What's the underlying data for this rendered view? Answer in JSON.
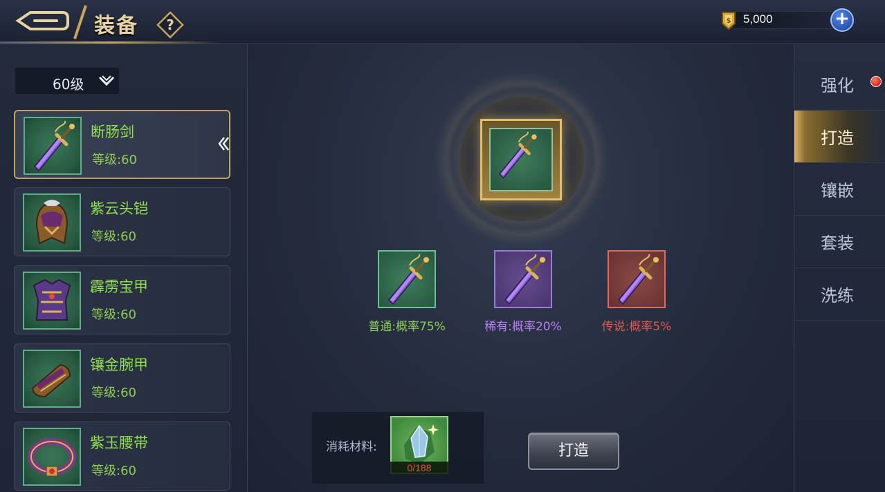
{
  "header": {
    "title": "装备",
    "help_symbol": "?",
    "currency": {
      "amount": "5,000",
      "plus": "+"
    }
  },
  "left": {
    "level_filter": "60级",
    "items": [
      {
        "name": "断肠剑",
        "level": "等级:60",
        "icon": "purple-sword-icon"
      },
      {
        "name": "紫云头铠",
        "level": "等级:60",
        "icon": "helmet-icon"
      },
      {
        "name": "霹雳宝甲",
        "level": "等级:60",
        "icon": "armor-icon"
      },
      {
        "name": "镶金腕甲",
        "level": "等级:60",
        "icon": "bracer-icon"
      },
      {
        "name": "紫玉腰带",
        "level": "等级:60",
        "icon": "belt-icon"
      }
    ]
  },
  "main": {
    "outcomes": [
      {
        "label": "普通:概率75%",
        "rarity": "common"
      },
      {
        "label": "稀有:概率20%",
        "rarity": "rare"
      },
      {
        "label": "传说:概率5%",
        "rarity": "legend"
      }
    ],
    "material": {
      "label": "消耗材料:",
      "count": "0/188",
      "icon": "material-crystal-icon"
    },
    "forge_button": "打造"
  },
  "tabs": [
    {
      "label": "强化",
      "has_dot": true
    },
    {
      "label": "打造",
      "active": true
    },
    {
      "label": "镶嵌"
    },
    {
      "label": "套装"
    },
    {
      "label": "洗练"
    }
  ],
  "colors": {
    "common": "#8fcf55",
    "rare": "#b67ef0",
    "legend": "#e0564c",
    "gold_accent": "#c2a25c"
  }
}
